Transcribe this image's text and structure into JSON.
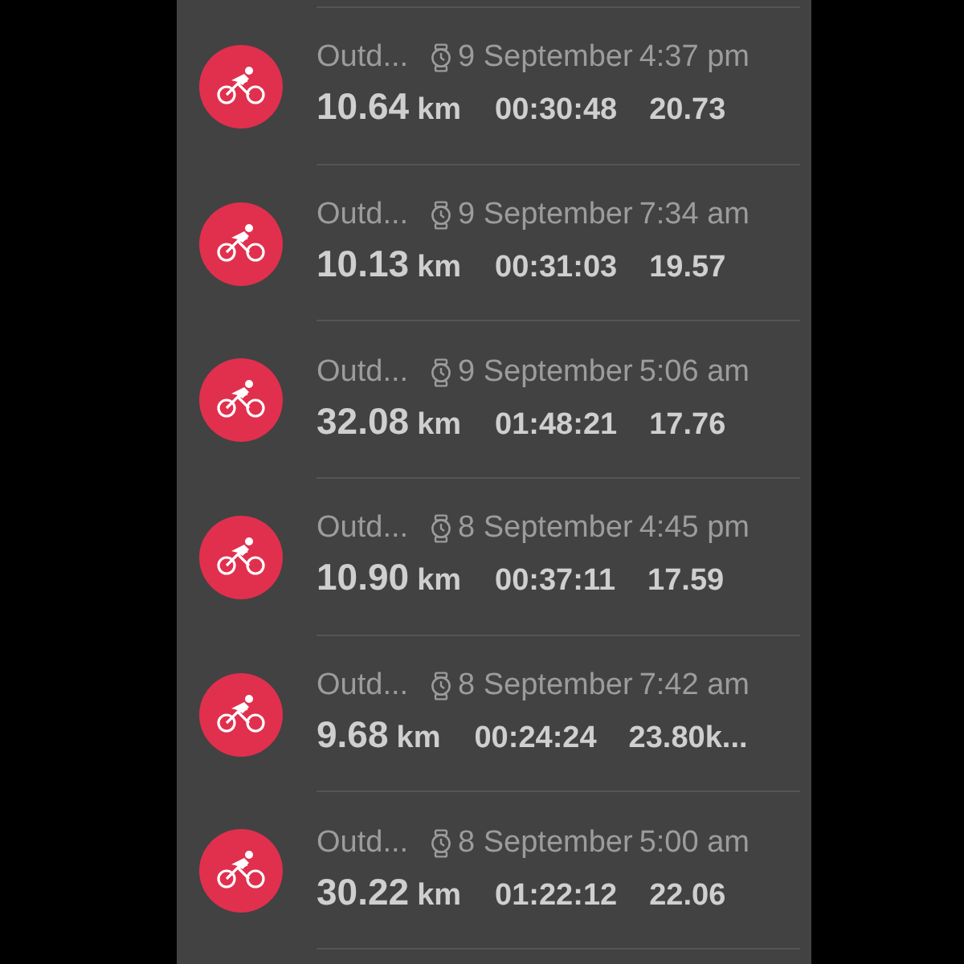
{
  "activities": [
    {
      "title": "Outd...",
      "date": "9 September",
      "time": "4:37 pm",
      "distance": "10.64",
      "distance_unit": "km",
      "duration": "00:30:48",
      "speed": "20.73"
    },
    {
      "title": "Outd...",
      "date": "9 September",
      "time": "7:34 am",
      "distance": "10.13",
      "distance_unit": "km",
      "duration": "00:31:03",
      "speed": "19.57"
    },
    {
      "title": "Outd...",
      "date": "9 September",
      "time": "5:06 am",
      "distance": "32.08",
      "distance_unit": "km",
      "duration": "01:48:21",
      "speed": "17.76"
    },
    {
      "title": "Outd...",
      "date": "8 September",
      "time": "4:45 pm",
      "distance": "10.90",
      "distance_unit": "km",
      "duration": "00:37:11",
      "speed": "17.59"
    },
    {
      "title": "Outd...",
      "date": "8 September",
      "time": "7:42 am",
      "distance": "9.68",
      "distance_unit": "km",
      "duration": "00:24:24",
      "speed": "23.80k..."
    },
    {
      "title": "Outd...",
      "date": "8 September",
      "time": "5:00 am",
      "distance": "30.22",
      "distance_unit": "km",
      "duration": "01:22:12",
      "speed": "22.06"
    }
  ]
}
